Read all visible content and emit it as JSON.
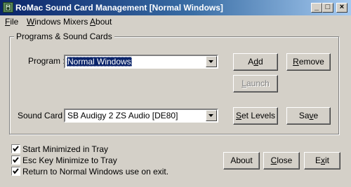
{
  "window": {
    "title": "RoMac Sound Card Management  [Normal Windows]",
    "controls": {
      "minimize": "_",
      "maximize": "□",
      "close": "×"
    }
  },
  "menu": [
    {
      "label": "File",
      "mnemonic": "F",
      "rest": "ile"
    },
    {
      "label": "Windows Mixers",
      "mnemonic": "W",
      "rest": "indows Mixers"
    },
    {
      "label": "About",
      "mnemonic": "A",
      "rest": "bout"
    }
  ],
  "group": {
    "title": "Programs & Sound Cards",
    "program_label": "Program :",
    "program_value": "Normal Windows",
    "soundcard_label": "Sound Card :",
    "soundcard_value": "SB Audigy 2 ZS Audio [DE80]"
  },
  "buttons": {
    "add": {
      "pre": "A",
      "u": "d",
      "post": "d"
    },
    "remove": {
      "pre": "",
      "u": "R",
      "post": "emove"
    },
    "launch": {
      "pre": "",
      "u": "L",
      "post": "aunch"
    },
    "set_levels": {
      "pre": "",
      "u": "S",
      "post": "et Levels"
    },
    "save": {
      "pre": "Sa",
      "u": "v",
      "post": "e"
    },
    "about": {
      "pre": "About",
      "u": "",
      "post": ""
    },
    "close": {
      "pre": "",
      "u": "C",
      "post": "lose"
    },
    "exit": {
      "pre": "E",
      "u": "x",
      "post": "it"
    }
  },
  "options": [
    {
      "label": "Start Minimized in Tray",
      "checked": true
    },
    {
      "label": "Esc Key Minimize to Tray",
      "checked": true
    },
    {
      "label": "Return to Normal Windows use on exit.",
      "checked": true
    }
  ],
  "icons": {
    "app": "speaker-app-icon",
    "dropdown": "chevron-down-icon",
    "check": "checkmark-icon"
  }
}
